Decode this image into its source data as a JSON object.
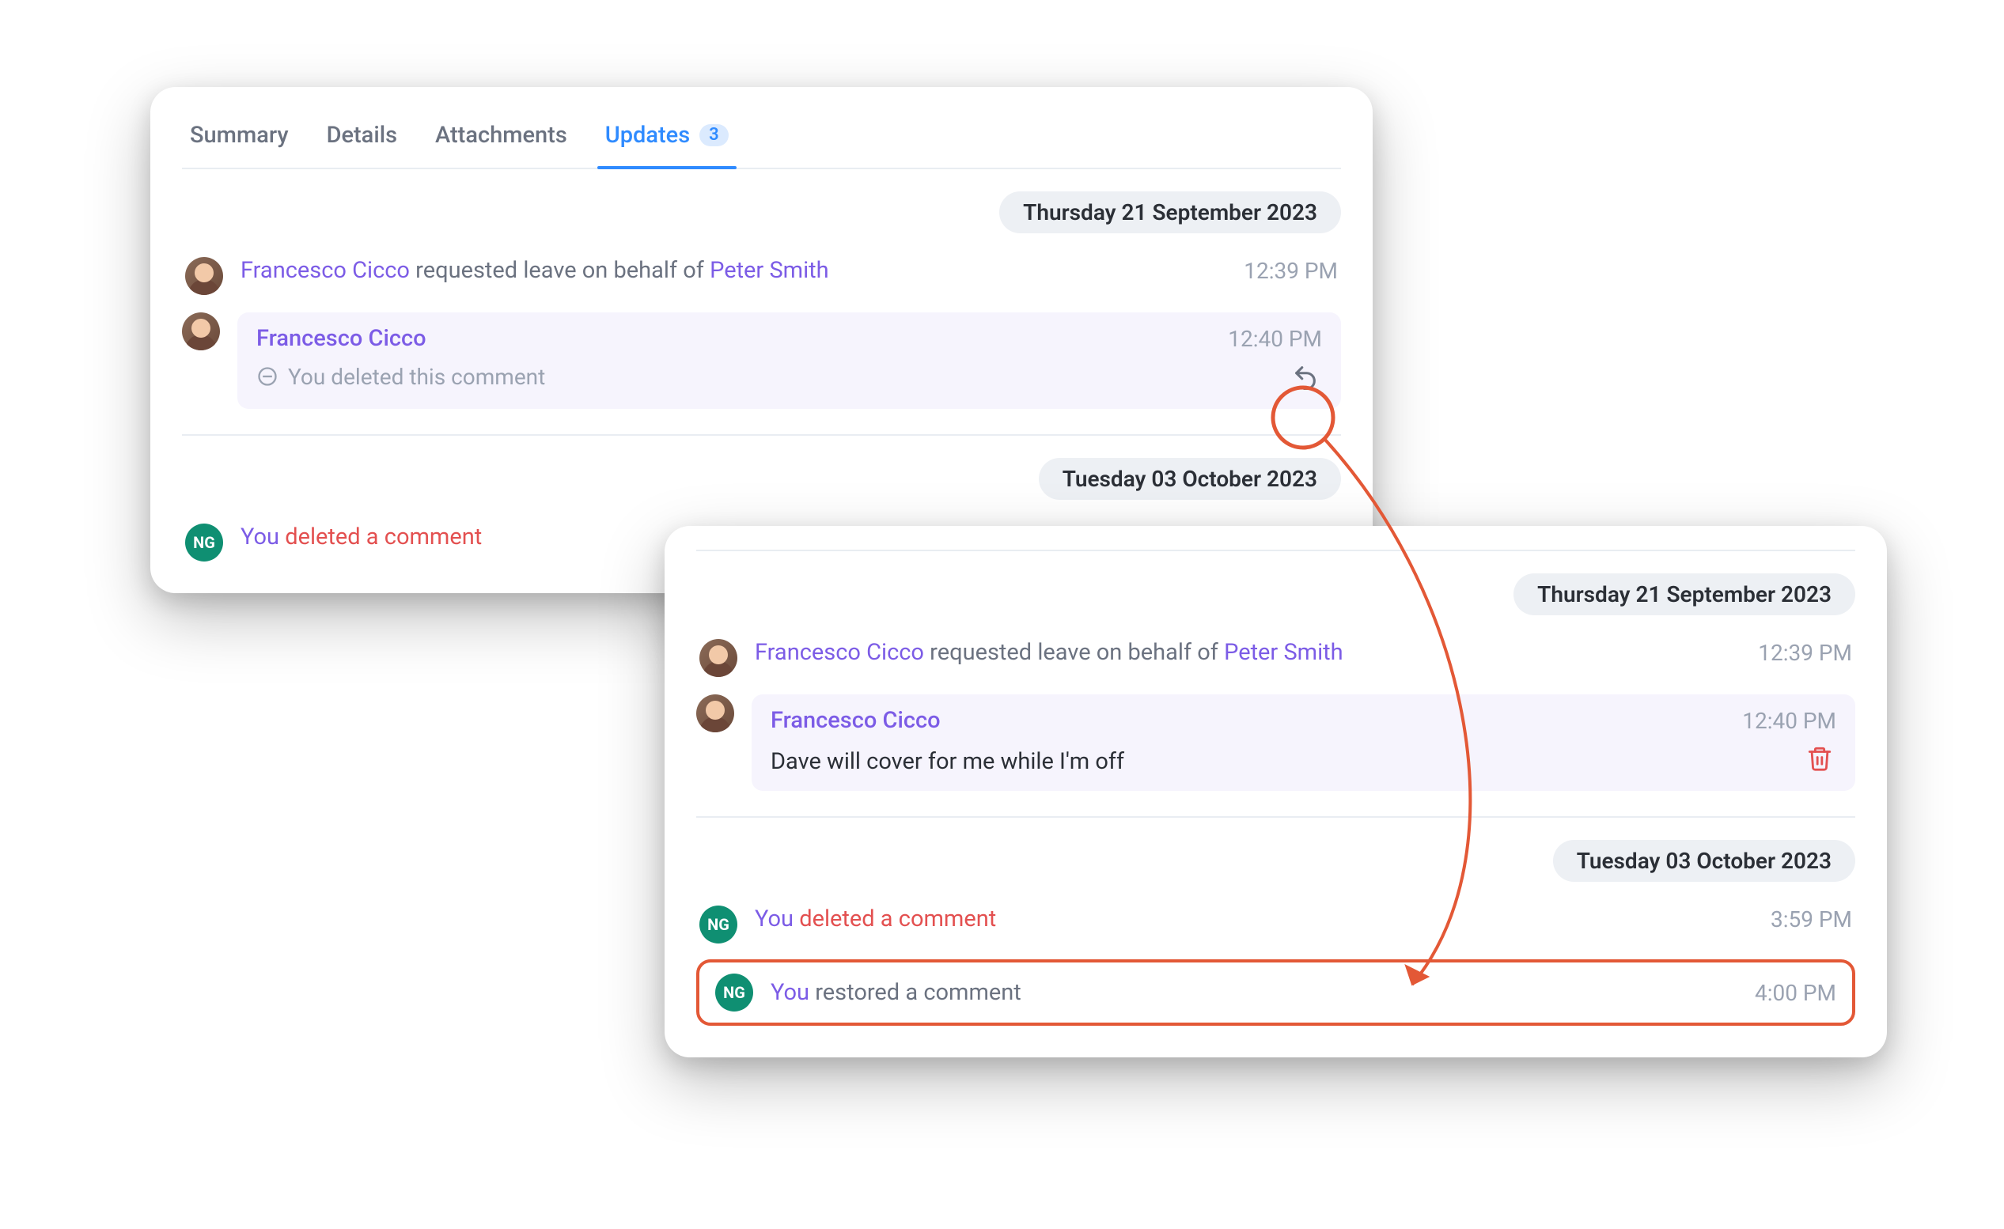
{
  "tabs": {
    "summary": "Summary",
    "details": "Details",
    "attachments": "Attachments",
    "updates": "Updates",
    "updates_count": "3"
  },
  "dates": {
    "d1": "Thursday 21 September 2023",
    "d2": "Tuesday 03 October 2023"
  },
  "users": {
    "francesco": "Francesco Cicco",
    "peter": "Peter Smith",
    "ng_initials": "NG"
  },
  "panelA": {
    "entry1_mid": " requested leave on behalf of ",
    "entry1_time": "12:39 PM",
    "comment_time": "12:40 PM",
    "deleted_note": "You deleted this comment",
    "entry2_you": "You",
    "entry2_action": " deleted a comment"
  },
  "panelB": {
    "entry1_mid": " requested leave on behalf of ",
    "entry1_time": "12:39 PM",
    "comment_time": "12:40 PM",
    "comment_body": "Dave will cover for me while I'm off",
    "entry_del_you": "You",
    "entry_del_action": " deleted a comment",
    "entry_del_time": "3:59 PM",
    "entry_restore_you": "You",
    "entry_restore_action": " restored a comment",
    "entry_restore_time": "4:00 PM"
  }
}
